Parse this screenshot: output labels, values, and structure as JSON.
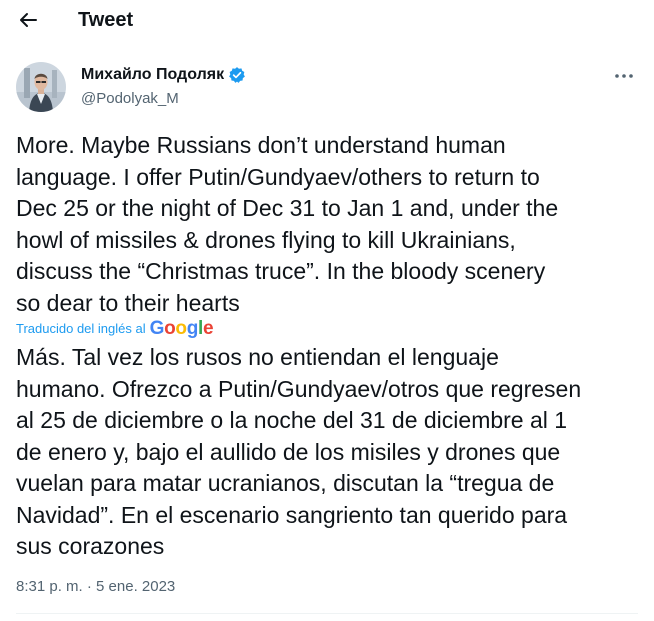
{
  "header": {
    "title": "Tweet",
    "back_icon": "arrow-left-icon"
  },
  "author": {
    "name": "Михайло Подоляк",
    "handle": "@Podolyak_M",
    "verified": true,
    "verified_color": "#1d9bf0"
  },
  "tweet": {
    "text": "More. Maybe Russians don’t understand human\nlanguage. I offer Putin/Gundyaev/others to return to\nDec 25 or the night of Dec 31 to Jan 1 and, under the\nhowl of missiles & drones flying to kill Ukrainians,\ndiscuss the “Christmas truce”. In the bloody scenery\nso dear to their hearts",
    "translated_by_label": "Traducido del inglés al",
    "translation_provider": "Google",
    "translated_text": "Más. Tal vez los rusos no entiendan el lenguaje\nhumano. Ofrezco a Putin/Gundyaev/otros que regresen\nal 25 de diciembre o la noche del 31 de diciembre al 1\nde enero y, bajo el aullido de los misiles y drones que\nvuelan para matar ucranianos, discutan la “tregua de\nNavidad”. En el escenario sangriento tan querido para\nsus corazones",
    "timestamp": "8:31 p. m. · 5 ene. 2023"
  },
  "colors": {
    "text": "#0f1419",
    "secondary": "#536471",
    "link": "#1d9bf0",
    "divider": "#eff3f4"
  }
}
